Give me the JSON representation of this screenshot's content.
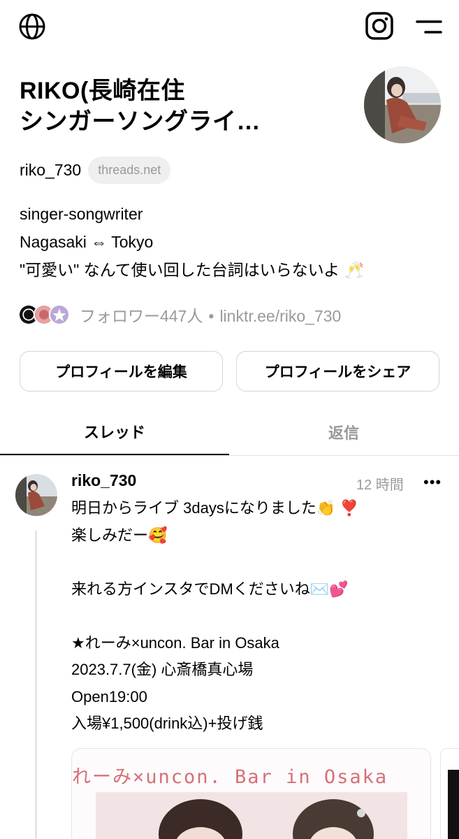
{
  "topbar": {
    "left_icon": "globe-icon",
    "right_icons": [
      "instagram-icon",
      "menu-icon"
    ]
  },
  "profile": {
    "name_line1": "RIKO(長崎在住",
    "name_line2": "シンガーソングライ…",
    "handle": "riko_730",
    "domain_pill": "threads.net",
    "bio": [
      "singer-songwriter",
      "Nagasaki ⇔ Tokyo",
      "\"可愛い\" なんて使い回した台詞はいらないよ 🥂"
    ],
    "followers_text": "フォロワー447人",
    "separator": "•",
    "link_text": "linktr.ee/riko_730"
  },
  "buttons": {
    "edit": "プロフィールを編集",
    "share": "プロフィールをシェア"
  },
  "tabs": {
    "threads": "スレッド",
    "replies": "返信"
  },
  "post": {
    "username": "riko_730",
    "time": "12 時間",
    "more": "•••",
    "lines": [
      "明日からライブ 3daysになりました👏 ❣️",
      "楽しみだー🥰",
      "",
      "来れる方インスタでDMくださいね✉️💕",
      "",
      "★れーみ×uncon. Bar in Osaka",
      "2023.7.7(金) 心斎橋真心場",
      "Open19:00",
      "入場¥1,500(drink込)+投げ銭"
    ],
    "media_title": "れーみ×uncon. Bar in Osaka"
  },
  "colors": {
    "muted": "#9a9a9a",
    "border": "#d5d5d5",
    "media_title": "#d4707a"
  }
}
